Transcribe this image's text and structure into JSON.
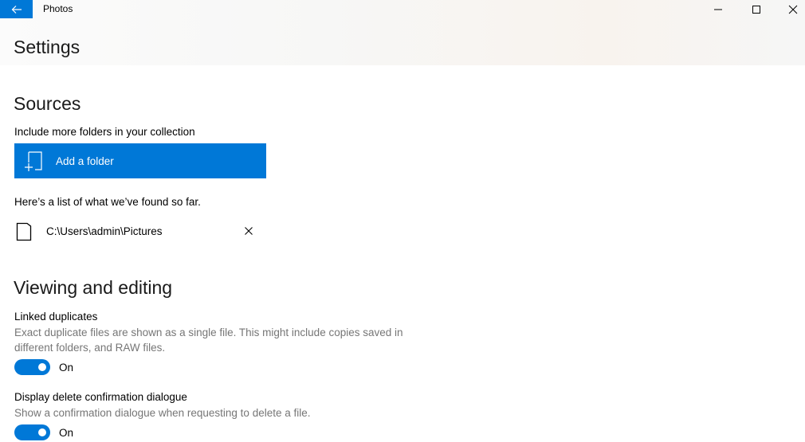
{
  "window": {
    "app_title": "Photos",
    "accent_color": "#0078d7"
  },
  "page": {
    "title": "Settings"
  },
  "sources": {
    "title": "Sources",
    "include_text": "Include more folders in your collection",
    "add_folder_label": "Add a folder",
    "found_text": "Here’s a list of what we’ve found so far.",
    "folders": [
      {
        "path": "C:\\Users\\admin\\Pictures"
      }
    ]
  },
  "viewing": {
    "title": "Viewing and editing",
    "linked_duplicates": {
      "label": "Linked duplicates",
      "description": "Exact duplicate files are shown as a single file. This might include copies saved in different folders, and RAW files.",
      "state": "On",
      "enabled": true
    },
    "delete_confirmation": {
      "label": "Display delete confirmation dialogue",
      "description": "Show a confirmation dialogue when requesting to delete a file.",
      "state": "On",
      "enabled": true
    }
  }
}
